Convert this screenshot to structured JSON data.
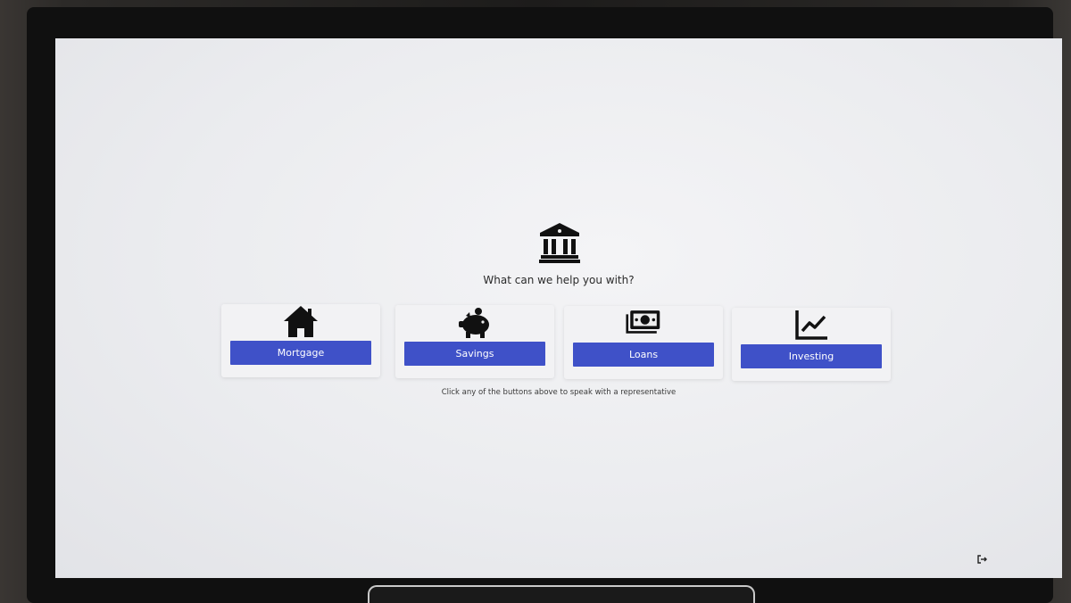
{
  "main": {
    "prompt": "What can we help you with?",
    "hint": "Click any of the buttons above to speak with a representative"
  },
  "icons": {
    "header": "bank-icon",
    "logout": "logout-icon"
  },
  "services": [
    {
      "label": "Mortgage",
      "icon": "house-icon"
    },
    {
      "label": "Savings",
      "icon": "piggy-bank-icon"
    },
    {
      "label": "Loans",
      "icon": "money-bill-icon"
    },
    {
      "label": "Investing",
      "icon": "chart-line-icon"
    }
  ],
  "colors": {
    "button": "#3f51c8",
    "button_text": "#ffffff",
    "background": "#ebecef"
  }
}
